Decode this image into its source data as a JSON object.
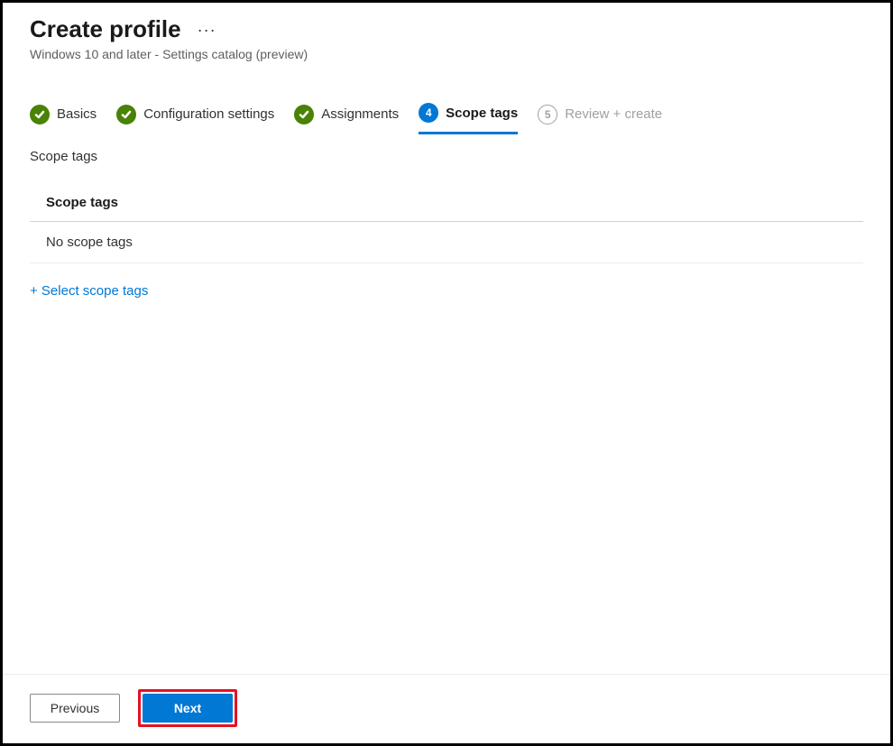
{
  "header": {
    "title": "Create profile",
    "subtitle": "Windows 10 and later - Settings catalog (preview)"
  },
  "stepper": {
    "steps": [
      {
        "label": "Basics",
        "state": "done"
      },
      {
        "label": "Configuration settings",
        "state": "done"
      },
      {
        "label": "Assignments",
        "state": "done"
      },
      {
        "number": "4",
        "label": "Scope tags",
        "state": "current"
      },
      {
        "number": "5",
        "label": "Review + create",
        "state": "pending"
      }
    ]
  },
  "main": {
    "section_label": "Scope tags",
    "table": {
      "header": "Scope tags",
      "empty_row": "No scope tags"
    },
    "select_link": "+ Select scope tags"
  },
  "footer": {
    "previous_label": "Previous",
    "next_label": "Next"
  }
}
